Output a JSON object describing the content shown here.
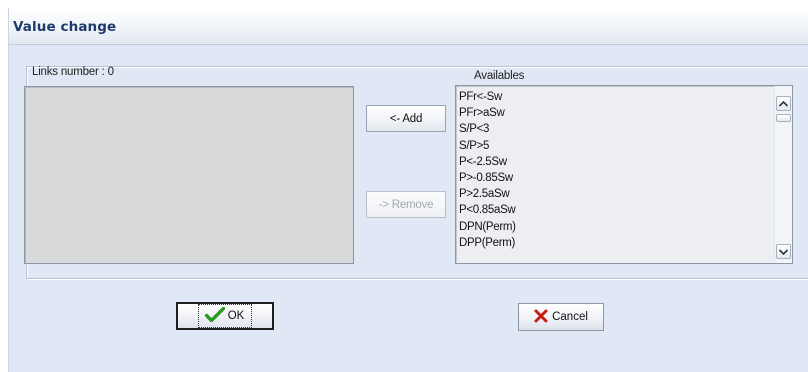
{
  "window": {
    "title": "Value change"
  },
  "links": {
    "label": "Links number : 0",
    "items": []
  },
  "buttons": {
    "add_label": "<- Add",
    "remove_label": "-> Remove",
    "ok_label": "OK",
    "cancel_label": "Cancel"
  },
  "availables": {
    "label": "Availables",
    "items": [
      "PFr<-Sw",
      "PFr>aSw",
      "S/P<3",
      "S/P>5",
      "P<-2.5Sw",
      "P>-0.85Sw",
      "P>2.5aSw",
      "P<0.85aSw",
      "DPN(Perm)",
      "DPP(Perm)"
    ]
  },
  "icons": {
    "ok": "check-icon",
    "cancel": "x-icon",
    "scroll_up": "scroll-up-arrow-icon",
    "scroll_down": "scroll-down-arrow-icon"
  },
  "colors": {
    "title_text": "#1e3a6a",
    "window_bg": "#dfe8f4",
    "check_green": "#2a9b1e",
    "cancel_red": "#c81b12"
  }
}
